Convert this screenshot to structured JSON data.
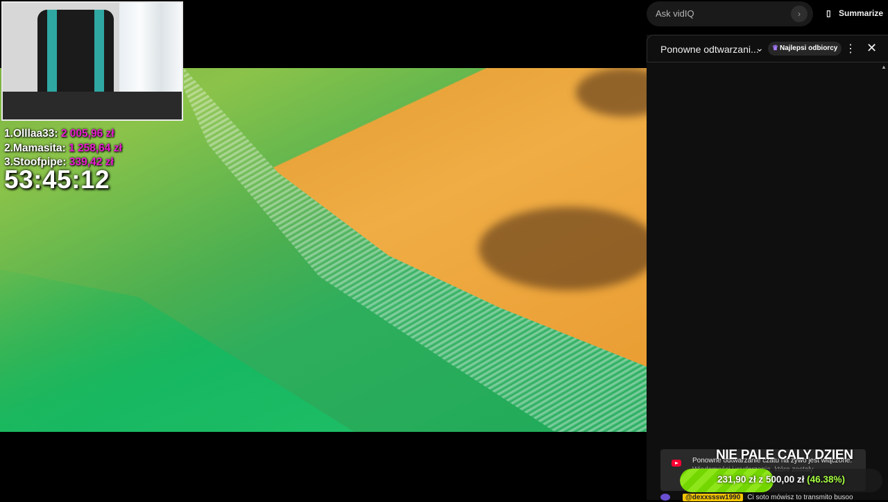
{
  "overlay": {
    "leaderboard": [
      {
        "rank": "1.",
        "name": "Olllaa33:",
        "amount": "2 005,96 zł"
      },
      {
        "rank": "2.",
        "name": "Mamasita:",
        "amount": "1 258,64 zł"
      },
      {
        "rank": "3.",
        "name": "Stoofpipe:",
        "amount": "339,42 zł"
      }
    ],
    "timer": "53:45:12",
    "accent": "#e81ccf"
  },
  "sidebar": {
    "ask_placeholder": "Ask vidIQ",
    "summarize_label": "Summarize",
    "chat_title": "Ponowne odtwarzani...",
    "top_fans_badge": "Najlepsi odbiorcy",
    "replay_notice_line1": "Ponowne odtwarzanie czatu na żywo jest włączone.",
    "replay_notice_line2": "Wiadomości i wydarzenia, które zostały",
    "goal_title": "NIE PALE CALY DZIEN",
    "goal_current": "231,90 zł",
    "goal_sep": "z",
    "goal_target": "500,00 zł",
    "goal_percent": "(46.38%)",
    "goal_fraction": 0.4638,
    "chat_user": "@dexxsssw1990",
    "chat_message": "Ci soto mówisz to transmito busoo"
  }
}
